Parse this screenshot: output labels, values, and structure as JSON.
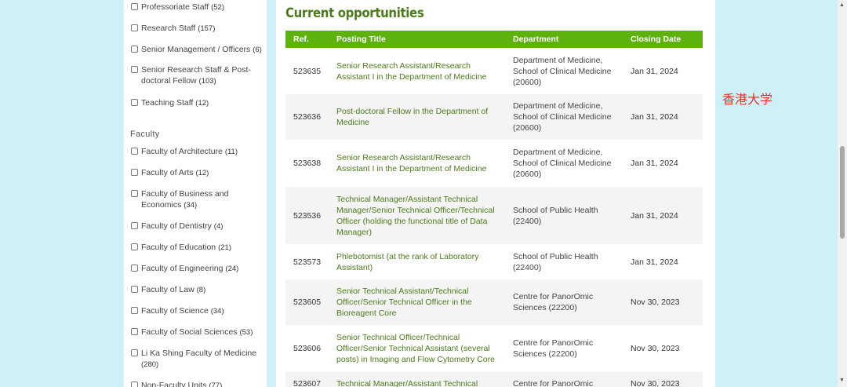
{
  "sidebar": {
    "staff_items": [
      {
        "label": "Professoriate Staff",
        "count": "(52)"
      },
      {
        "label": "Research Staff",
        "count": "(157)"
      },
      {
        "label": "Senior Management / Officers",
        "count": "(6)"
      },
      {
        "label": "Senior Research Staff & Post-doctoral Fellow",
        "count": "(103)"
      },
      {
        "label": "Teaching Staff",
        "count": "(12)"
      }
    ],
    "faculty_heading": "Faculty",
    "faculty_items": [
      {
        "label": "Faculty of Architecture",
        "count": "(11)"
      },
      {
        "label": "Faculty of Arts",
        "count": "(12)"
      },
      {
        "label": "Faculty of Business and Economics",
        "count": "(34)"
      },
      {
        "label": "Faculty of Dentistry",
        "count": "(4)"
      },
      {
        "label": "Faculty of Education",
        "count": "(21)"
      },
      {
        "label": "Faculty of Engineering",
        "count": "(24)"
      },
      {
        "label": "Faculty of Law",
        "count": "(8)"
      },
      {
        "label": "Faculty of Science",
        "count": "(34)"
      },
      {
        "label": "Faculty of Social Sciences",
        "count": "(53)"
      },
      {
        "label": "Li Ka Shing Faculty of Medicine",
        "count": "(280)"
      },
      {
        "label": "Non-Faculty Units",
        "count": "(77)"
      }
    ]
  },
  "main": {
    "heading": "Current opportunities",
    "columns": {
      "ref": "Ref.",
      "title": "Posting Title",
      "dept": "Department",
      "date": "Closing Date"
    },
    "rows": [
      {
        "ref": "523635",
        "title": "Senior Research Assistant/Research Assistant I in the Department of Medicine",
        "dept": "Department of Medicine, School of Clinical Medicine (20600)",
        "date": "Jan 31, 2024"
      },
      {
        "ref": "523636",
        "title": "Post-doctoral Fellow in the Department of Medicine",
        "dept": "Department of Medicine, School of Clinical Medicine (20600)",
        "date": "Jan 31, 2024"
      },
      {
        "ref": "523638",
        "title": "Senior Research Assistant/Research Assistant I in the Department of Medicine",
        "dept": "Department of Medicine, School of Clinical Medicine (20600)",
        "date": "Jan 31, 2024"
      },
      {
        "ref": "523536",
        "title": "Technical Manager/Assistant Technical Manager/Senior Technical Officer/Technical Officer (holding the functional title of Data Manager)",
        "dept": "School of Public Health (22400)",
        "date": "Jan 31, 2024"
      },
      {
        "ref": "523573",
        "title": "Phlebotomist (at the rank of Laboratory Assistant)",
        "dept": "School of Public Health (22400)",
        "date": "Jan 31, 2024"
      },
      {
        "ref": "523605",
        "title": "Senior Technical Assistant/Technical Officer/Senior Technical Officer in the Bioreagent Core",
        "dept": "Centre for PanorOmic Sciences (22200)",
        "date": "Nov 30, 2023"
      },
      {
        "ref": "523606",
        "title": "Senior Technical Officer/Technical Officer/Senior Technical Assistant (several posts) in Imaging and Flow Cytometry Core",
        "dept": "Centre for PanorOmic Sciences (22200)",
        "date": "Nov 30, 2023"
      },
      {
        "ref": "523607",
        "title": "Technical Manager/Assistant Technical",
        "dept": "Centre for PanorOmic",
        "date": "Nov 30, 2023"
      }
    ]
  },
  "watermark": "香港大学"
}
